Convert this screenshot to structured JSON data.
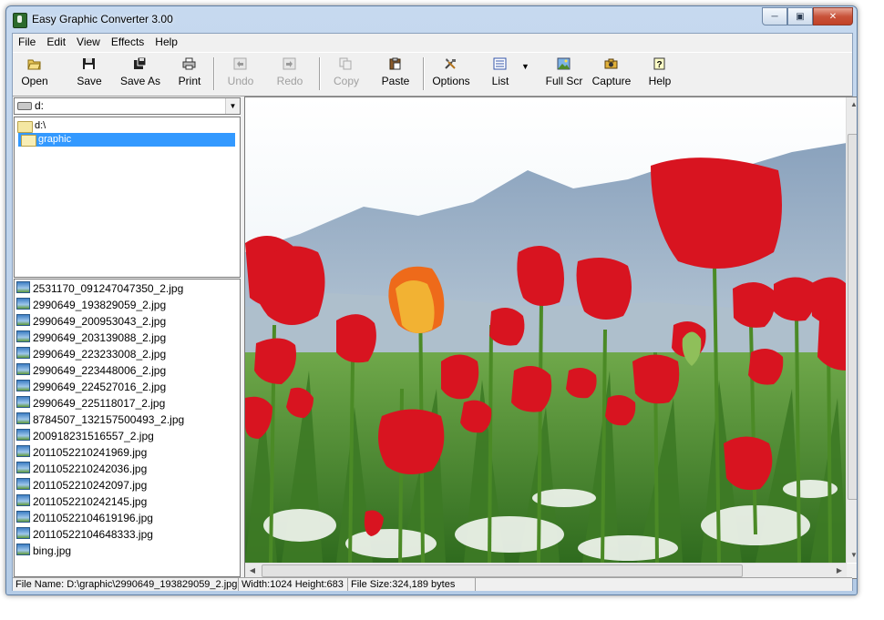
{
  "window": {
    "title": "Easy Graphic Converter 3.00"
  },
  "menu": [
    "File",
    "Edit",
    "View",
    "Effects",
    "Help"
  ],
  "toolbar": {
    "open": "Open",
    "save": "Save",
    "save_as": "Save As",
    "print": "Print",
    "undo": "Undo",
    "redo": "Redo",
    "copy": "Copy",
    "paste": "Paste",
    "options": "Options",
    "list": "List",
    "full_scr": "Full Scr",
    "capture": "Capture",
    "help": "Help"
  },
  "drive": "d:",
  "folders": [
    "d:\\",
    "graphic"
  ],
  "files": [
    "2531170_091247047350_2.jpg",
    "2990649_193829059_2.jpg",
    "2990649_200953043_2.jpg",
    "2990649_203139088_2.jpg",
    "2990649_223233008_2.jpg",
    "2990649_223448006_2.jpg",
    "2990649_224527016_2.jpg",
    "2990649_225118017_2.jpg",
    "8784507_132157500493_2.jpg",
    "200918231516557_2.jpg",
    "20110522102419 69.jpg",
    "20110522102420 36.jpg",
    "20110522102420 97.jpg",
    "20110522102421 45.jpg",
    "20110522104619196.jpg",
    "20110522104648333.jpg",
    "bing.jpg"
  ],
  "status": {
    "file_name": "File Name: D:\\graphic\\2990649_193829059_2.jpg",
    "dimensions": "Width:1024  Height:683",
    "file_size": "File Size:324,189 bytes"
  },
  "colors": {
    "selection": "#3399ff",
    "sky": "#dce9f2",
    "mountain": "#7d93b0",
    "tulip": "#d81420",
    "stem": "#4f8a2a"
  }
}
